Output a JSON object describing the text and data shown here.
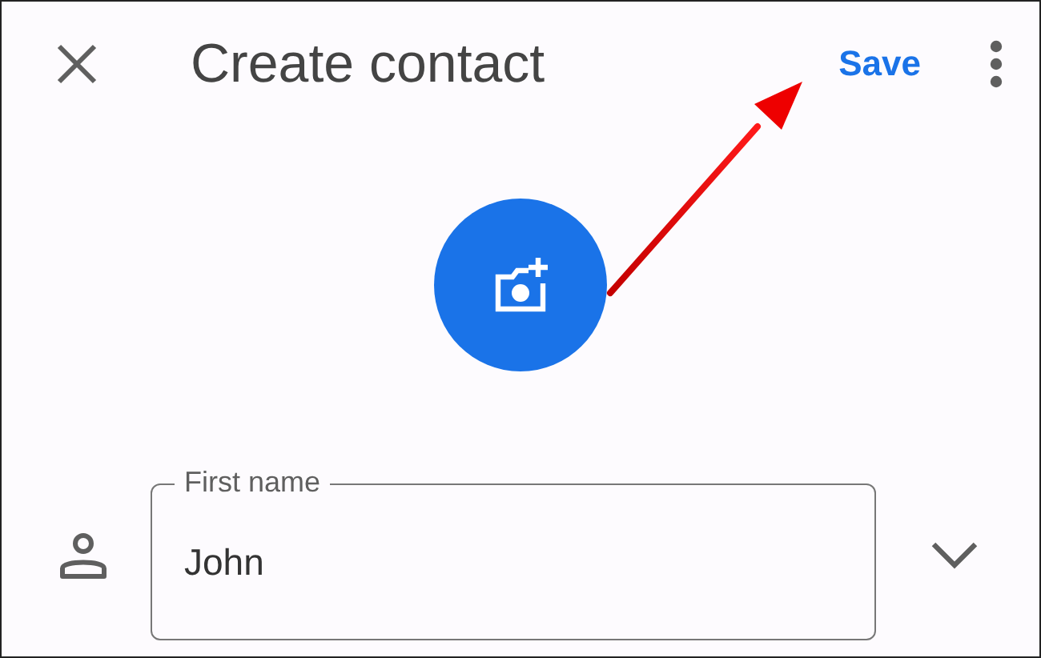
{
  "app_bar": {
    "title": "Create contact",
    "save_label": "Save"
  },
  "name_field": {
    "label": "First name",
    "value": "John"
  }
}
